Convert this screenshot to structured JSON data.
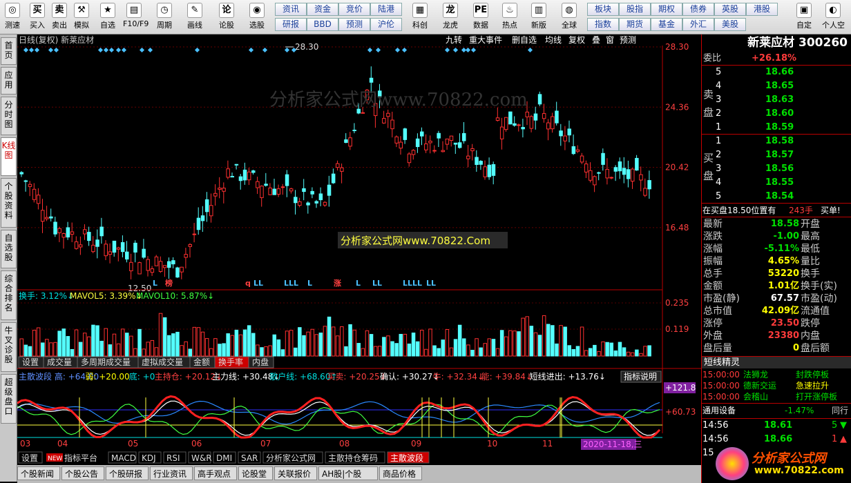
{
  "toolbar": {
    "buttons": [
      {
        "label": "测速",
        "icon": "speed-icon",
        "glyph": "◎"
      },
      {
        "label": "买入",
        "icon": "buy-icon",
        "glyph": "买"
      },
      {
        "label": "卖出",
        "icon": "sell-icon",
        "glyph": "卖"
      },
      {
        "label": "模拟",
        "icon": "hammer-icon",
        "glyph": "⚒"
      },
      {
        "label": "自选",
        "icon": "star-icon",
        "glyph": "★"
      },
      {
        "label": "F10/F9",
        "icon": "info-card-icon",
        "glyph": "▤"
      },
      {
        "label": "周期",
        "icon": "clock-icon",
        "glyph": "◷"
      },
      {
        "label": "画线",
        "icon": "pencil-icon",
        "glyph": "✎"
      },
      {
        "label": "论股",
        "icon": "forum-icon",
        "glyph": "论"
      },
      {
        "label": "选股",
        "icon": "stock-pick-icon",
        "glyph": "◉"
      },
      {
        "label": "科创",
        "icon": "chart-icon",
        "glyph": "▦"
      },
      {
        "label": "龙虎",
        "icon": "dragon-icon",
        "glyph": "龙"
      },
      {
        "label": "数据",
        "icon": "pe-icon",
        "glyph": "PE"
      },
      {
        "label": "热点",
        "icon": "fire-icon",
        "glyph": "♨"
      },
      {
        "label": "新版",
        "icon": "new-version-icon",
        "glyph": "▥"
      },
      {
        "label": "全球",
        "icon": "globe-icon",
        "glyph": "◍"
      },
      {
        "label": "自定",
        "icon": "custom-icon",
        "glyph": "▣"
      },
      {
        "label": "个人空",
        "icon": "user-icon",
        "glyph": "◐"
      }
    ],
    "quick_top": [
      "资讯",
      "资金",
      "竞价",
      "陆港"
    ],
    "quick_bottom": [
      "研报",
      "BBD",
      "预测",
      "沪伦"
    ],
    "quick_right_top": [
      "板块",
      "股指",
      "期权",
      "债券",
      "英股",
      "港股"
    ],
    "quick_right_bottom": [
      "指数",
      "期货",
      "基金",
      "外汇",
      "美股"
    ]
  },
  "sidetabs": [
    {
      "label": "首页",
      "active": false
    },
    {
      "label": "应用",
      "active": false
    },
    {
      "label": "分时图",
      "active": false
    },
    {
      "label": "K线图",
      "active": true
    },
    {
      "label": "个股资料",
      "active": false
    },
    {
      "label": "自选股",
      "active": false
    },
    {
      "label": "综合排名",
      "active": false
    },
    {
      "label": "牛叉诊股",
      "active": false
    },
    {
      "label": "超级盘口",
      "active": false
    }
  ],
  "chart_header": {
    "left": "日线(复权)  新莱应材",
    "buttons": [
      "九转",
      "重大事件",
      "删自选",
      "均线",
      "复权",
      "叠",
      "窗",
      "预测"
    ]
  },
  "price_axis": [
    "28.30",
    "24.36",
    "20.42",
    "16.48"
  ],
  "annotations": {
    "high": "28.30",
    "low": "12.50"
  },
  "marks": [
    "L",
    "榜",
    "q",
    "LL",
    "LLL",
    "L",
    "涨",
    "L",
    "LL",
    "LLLL",
    "LL"
  ],
  "watermark": "分析家公式网www.70822.com",
  "watermark_box": "分析家公式网www.70822.Com",
  "volume_header": {
    "hsl": "换手: 3.12%↓",
    "ma5": "MAVOL5: 3.39%↓",
    "ma10": "MAVOL10: 5.87%↓"
  },
  "volume_axis": [
    "0.235",
    "0.119"
  ],
  "mid_tabs": [
    {
      "label": "设置",
      "active": false
    },
    {
      "label": "成交量",
      "active": false
    },
    {
      "label": "多周期成交量",
      "active": false
    },
    {
      "label": "虚拟成交量",
      "active": false
    },
    {
      "label": "金额",
      "active": false
    },
    {
      "label": "换手率",
      "active": true
    },
    {
      "label": "内盘",
      "active": false
    }
  ],
  "ind_header": [
    {
      "t": "主散波段 高: +64.00",
      "c": "#5f8fff"
    },
    {
      "t": "弱: +20.00",
      "c": "#ffff00"
    },
    {
      "t": "底: +0",
      "c": "#00e0e0"
    },
    {
      "t": "主持仓: +20.12↓",
      "c": "#ff4040"
    },
    {
      "t": "主力线: +30.48↓",
      "c": "#ffffff"
    },
    {
      "t": "散户线: +68.60↑",
      "c": "#00e0e0"
    },
    {
      "t": "买卖: +20.25↓",
      "c": "#ff4040"
    },
    {
      "t": "确认: +30.27↓",
      "c": "#ffffff"
    },
    {
      "t": "牛: +32.34↓",
      "c": "#ff4040"
    },
    {
      "t": "能: +39.84↓",
      "c": "#ff4040"
    },
    {
      "t": "短线进出: +13.76↓",
      "c": "#ffffff"
    }
  ],
  "ind_help": "指标说明",
  "ind_axis": [
    "+121.8",
    "+60.73"
  ],
  "months": [
    "03",
    "04",
    "05",
    "06",
    "07",
    "08",
    "09",
    "10",
    "11"
  ],
  "date_badge": "2020-11-18,三",
  "bottom_tabs": [
    {
      "label": "设置",
      "active": false
    },
    {
      "label": "指标平台",
      "active": false,
      "badge": "NEW"
    },
    {
      "label": "MACD",
      "active": false
    },
    {
      "label": "KDJ",
      "active": false
    },
    {
      "label": "RSI",
      "active": false
    },
    {
      "label": "W&R",
      "active": false
    },
    {
      "label": "DMI",
      "active": false
    },
    {
      "label": "SAR",
      "active": false
    },
    {
      "label": "分析家公式网",
      "active": false
    },
    {
      "label": "主散持仓筹码",
      "active": false
    },
    {
      "label": "主散波段",
      "active": true
    }
  ],
  "bottom_row": [
    "个股新闻",
    "个股公告",
    "个股研报",
    "行业资讯",
    "高手观点",
    "论股堂",
    "关联报价",
    "AH股|个股",
    "商品价格"
  ],
  "quote": {
    "name": "新莱应材",
    "code": "300260",
    "wb_label": "委比",
    "wb": "+26.18%",
    "sell_label": "卖盘",
    "buy_label": "买盘",
    "asks": [
      {
        "lvl": "5",
        "p": "18.66"
      },
      {
        "lvl": "4",
        "p": "18.65"
      },
      {
        "lvl": "3",
        "p": "18.63"
      },
      {
        "lvl": "2",
        "p": "18.60"
      },
      {
        "lvl": "1",
        "p": "18.59"
      }
    ],
    "bids": [
      {
        "lvl": "1",
        "p": "18.58"
      },
      {
        "lvl": "2",
        "p": "18.57"
      },
      {
        "lvl": "3",
        "p": "18.56"
      },
      {
        "lvl": "4",
        "p": "18.55"
      },
      {
        "lvl": "5",
        "p": "18.54"
      }
    ],
    "notice": "在买盘18.50位置有",
    "notice_vol": "243手",
    "notice_act": "买单!",
    "stats": [
      {
        "k": "最新",
        "v": "18.58",
        "vc": "grn",
        "k2": "开盘",
        "v2": ""
      },
      {
        "k": "涨跌",
        "v": "-1.00",
        "vc": "grn",
        "k2": "最高",
        "v2": ""
      },
      {
        "k": "涨幅",
        "v": "-5.11%",
        "vc": "grn",
        "k2": "最低",
        "v2": ""
      },
      {
        "k": "振幅",
        "v": "4.65%",
        "vc": "yel",
        "k2": "量比",
        "v2": ""
      },
      {
        "k": "总手",
        "v": "53220",
        "vc": "yel",
        "k2": "换手",
        "v2": ""
      },
      {
        "k": "金额",
        "v": "1.01亿",
        "vc": "yel",
        "k2": "换手(实)",
        "v2": ""
      },
      {
        "k": "市盈(静)",
        "v": "67.57",
        "vc": "wht",
        "k2": "市盈(动)",
        "v2": ""
      },
      {
        "k": "总市值",
        "v": "42.09亿",
        "vc": "yel",
        "k2": "流通值",
        "v2": ""
      },
      {
        "k": "涨停",
        "v": "23.50",
        "vc": "red",
        "k2": "跌停",
        "v2": ""
      },
      {
        "k": "外盘",
        "v": "23380",
        "vc": "red",
        "k2": "内盘",
        "v2": ""
      },
      {
        "k": "盘后量",
        "v": "0",
        "vc": "yel",
        "k2": "盘后额",
        "v2": ""
      }
    ],
    "sprite_title": "短线精灵",
    "sprites": [
      {
        "t": "15:00:00",
        "n": "法狮龙",
        "e": "封跌停板",
        "ec": "grn"
      },
      {
        "t": "15:00:00",
        "n": "德新交运",
        "e": "急速拉升",
        "ec": "yel"
      },
      {
        "t": "15:00:00",
        "n": "会稽山",
        "e": "打开涨停板",
        "ec": "grn"
      }
    ],
    "sector": "通用设备",
    "sector_chg": "-1.47%",
    "sector_more": "同行",
    "ticks": [
      {
        "t": "14:56",
        "p": "18.61",
        "v": "5",
        "dir": "down"
      },
      {
        "t": "14:56",
        "p": "18.66",
        "v": "1",
        "dir": "up"
      },
      {
        "t": "15",
        "p": "",
        "v": "",
        "dir": ""
      }
    ],
    "logo_text": "分析家公式网",
    "logo_url": "www.70822.com"
  }
}
